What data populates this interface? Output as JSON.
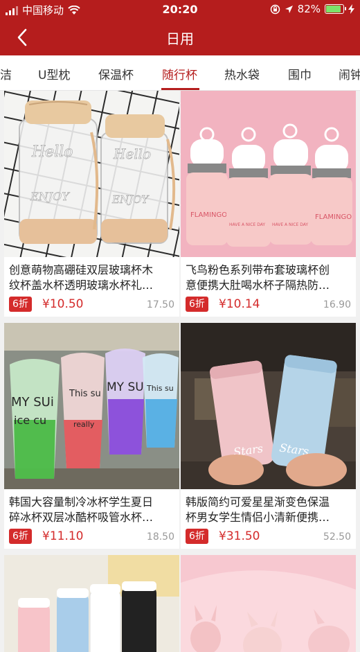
{
  "status": {
    "carrier": "中国移动",
    "time": "20:20",
    "battery": "82%",
    "battery_level": 0.82
  },
  "nav": {
    "title": "日用"
  },
  "tabs": [
    {
      "label": "洁"
    },
    {
      "label": "U型枕"
    },
    {
      "label": "保温杯"
    },
    {
      "label": "随行杯",
      "active": true
    },
    {
      "label": "热水袋"
    },
    {
      "label": "围巾"
    },
    {
      "label": "闹钟"
    }
  ],
  "products": [
    {
      "line1": "创意萌物高硼硅双层玻璃杯木",
      "line2": "纹杯盖水杯透明玻璃水杯礼…",
      "discount": "6折",
      "price": "¥10.50",
      "original": "17.50"
    },
    {
      "line1": "飞鸟粉色系列带布套玻璃杯创",
      "line2": "意便携大肚喝水杯子隔热防…",
      "discount": "6折",
      "price": "¥10.14",
      "original": "16.90"
    },
    {
      "line1": "韩国大容量制冷冰杯学生夏日",
      "line2": "碎冰杯双层冰酷杯吸管水杯…",
      "discount": "6折",
      "price": "¥11.10",
      "original": "18.50"
    },
    {
      "line1": "韩版简约可爱星星渐变色保温",
      "line2": "杯男女学生情侣小清新便携…",
      "discount": "6折",
      "price": "¥31.50",
      "original": "52.50"
    }
  ],
  "image_text": {
    "p1_word": "Hello",
    "p1_word2": "ENJOY",
    "p2_label": "FLAMINGO",
    "p2_label2": "HAVE A NICE DAY",
    "p3_left": "MY SUi",
    "p3_left2": "ice cu",
    "p3_mid": "This su",
    "p3_mid2": "really",
    "p4_left": "Stars",
    "p4_right": "Stars"
  }
}
